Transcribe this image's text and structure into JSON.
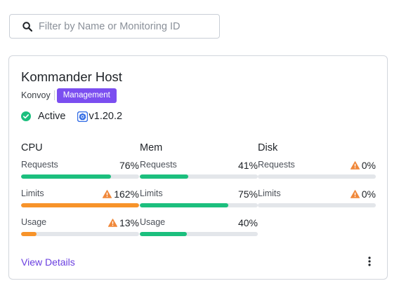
{
  "search": {
    "placeholder": "Filter by Name or Monitoring ID",
    "value": ""
  },
  "cluster": {
    "name": "Kommander Host",
    "provider": "Konvoy",
    "badge": "Management",
    "status": "Active",
    "version": "v1.20.2",
    "view_details": "View Details"
  },
  "colors": {
    "green": "#1cbf7e",
    "orange": "#f7932a",
    "warning": "#f0883a",
    "accent": "#7b4ef0",
    "track": "#e3e6ea"
  },
  "columns": [
    {
      "title": "CPU",
      "metrics": [
        {
          "label": "Requests",
          "value": "76%",
          "percent": 76,
          "warning": false,
          "color": "#1cbf7e"
        },
        {
          "label": "Limits",
          "value": "162%",
          "percent": 100,
          "warning": true,
          "color": "#f7932a"
        },
        {
          "label": "Usage",
          "value": "13%",
          "percent": 13,
          "warning": true,
          "color": "#f7932a"
        }
      ]
    },
    {
      "title": "Mem",
      "metrics": [
        {
          "label": "Requests",
          "value": "41%",
          "percent": 41,
          "warning": false,
          "color": "#1cbf7e"
        },
        {
          "label": "Limits",
          "value": "75%",
          "percent": 75,
          "warning": false,
          "color": "#1cbf7e"
        },
        {
          "label": "Usage",
          "value": "40%",
          "percent": 40,
          "warning": false,
          "color": "#1cbf7e"
        }
      ]
    },
    {
      "title": "Disk",
      "metrics": [
        {
          "label": "Requests",
          "value": "0%",
          "percent": 0,
          "warning": true,
          "color": "#1cbf7e"
        },
        {
          "label": "Limits",
          "value": "0%",
          "percent": 0,
          "warning": true,
          "color": "#1cbf7e"
        }
      ]
    }
  ]
}
